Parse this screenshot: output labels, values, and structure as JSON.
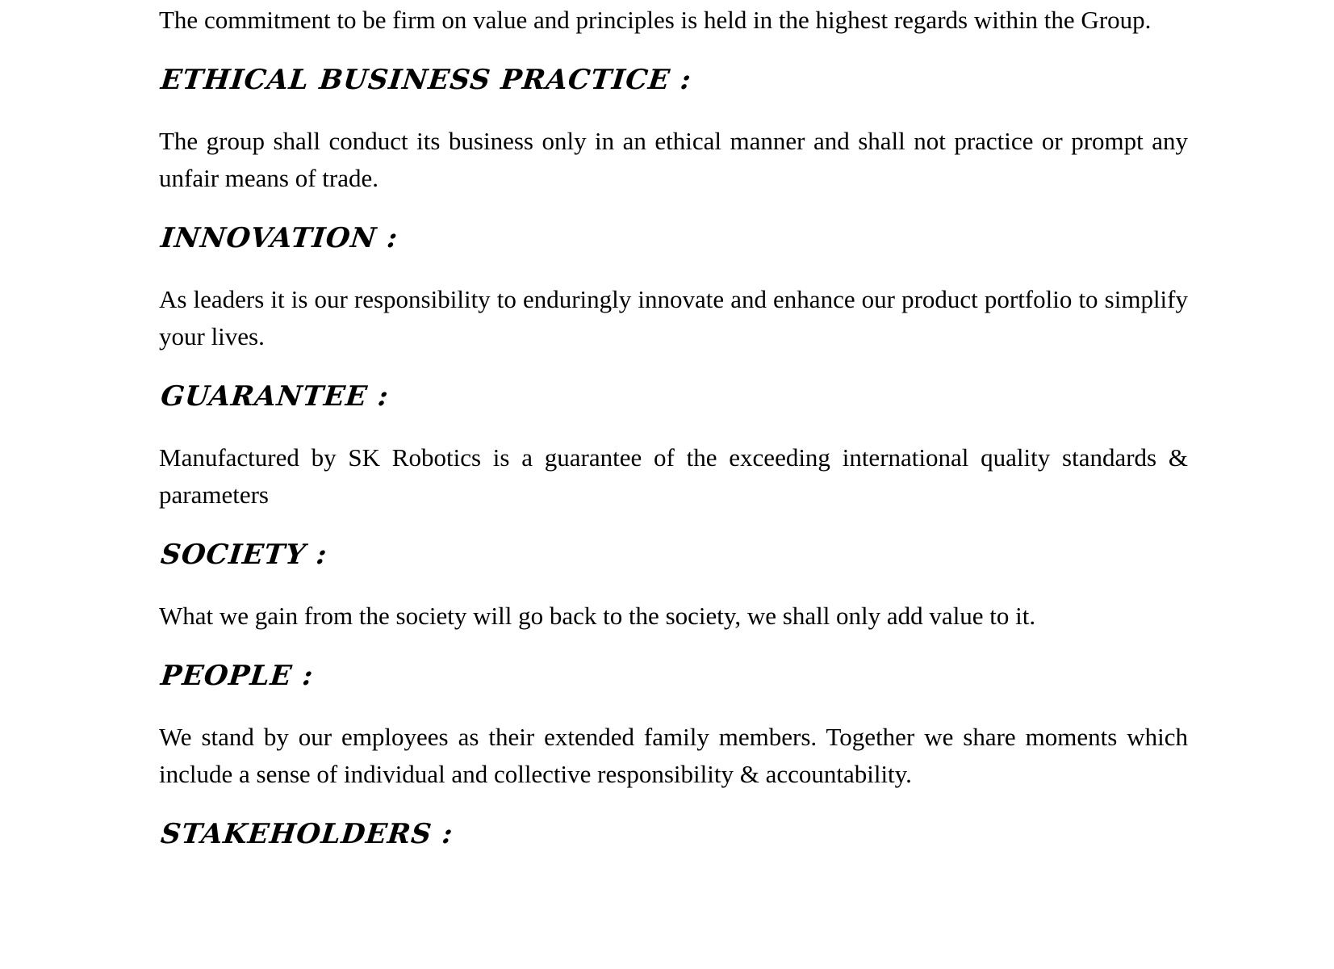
{
  "document": {
    "intro": "The commitment to be firm on value and principles is held in the highest regards within the Group.",
    "sections": [
      {
        "heading": "ETHICAL BUSINESS PRACTICE :",
        "body": "The group shall conduct its business only in an ethical manner and shall not practice or prompt any unfair means of trade."
      },
      {
        "heading": "INNOVATION  :",
        "body": "As leaders it is our responsibility to enduringly innovate and enhance our product portfolio to simplify your lives."
      },
      {
        "heading": "GUARANTEE :",
        "body": "Manufactured by SK Robotics is a guarantee of the exceeding international quality standards & parameters"
      },
      {
        "heading": "SOCIETY :",
        "body": "What we gain from the society will go back to the society, we shall only add value to it."
      },
      {
        "heading": "PEOPLE :",
        "body": "We stand by our employees as their extended family members. Together we share moments which include a sense of individual and collective responsibility & accountability."
      },
      {
        "heading": "STAKEHOLDERS :",
        "body": ""
      }
    ]
  }
}
